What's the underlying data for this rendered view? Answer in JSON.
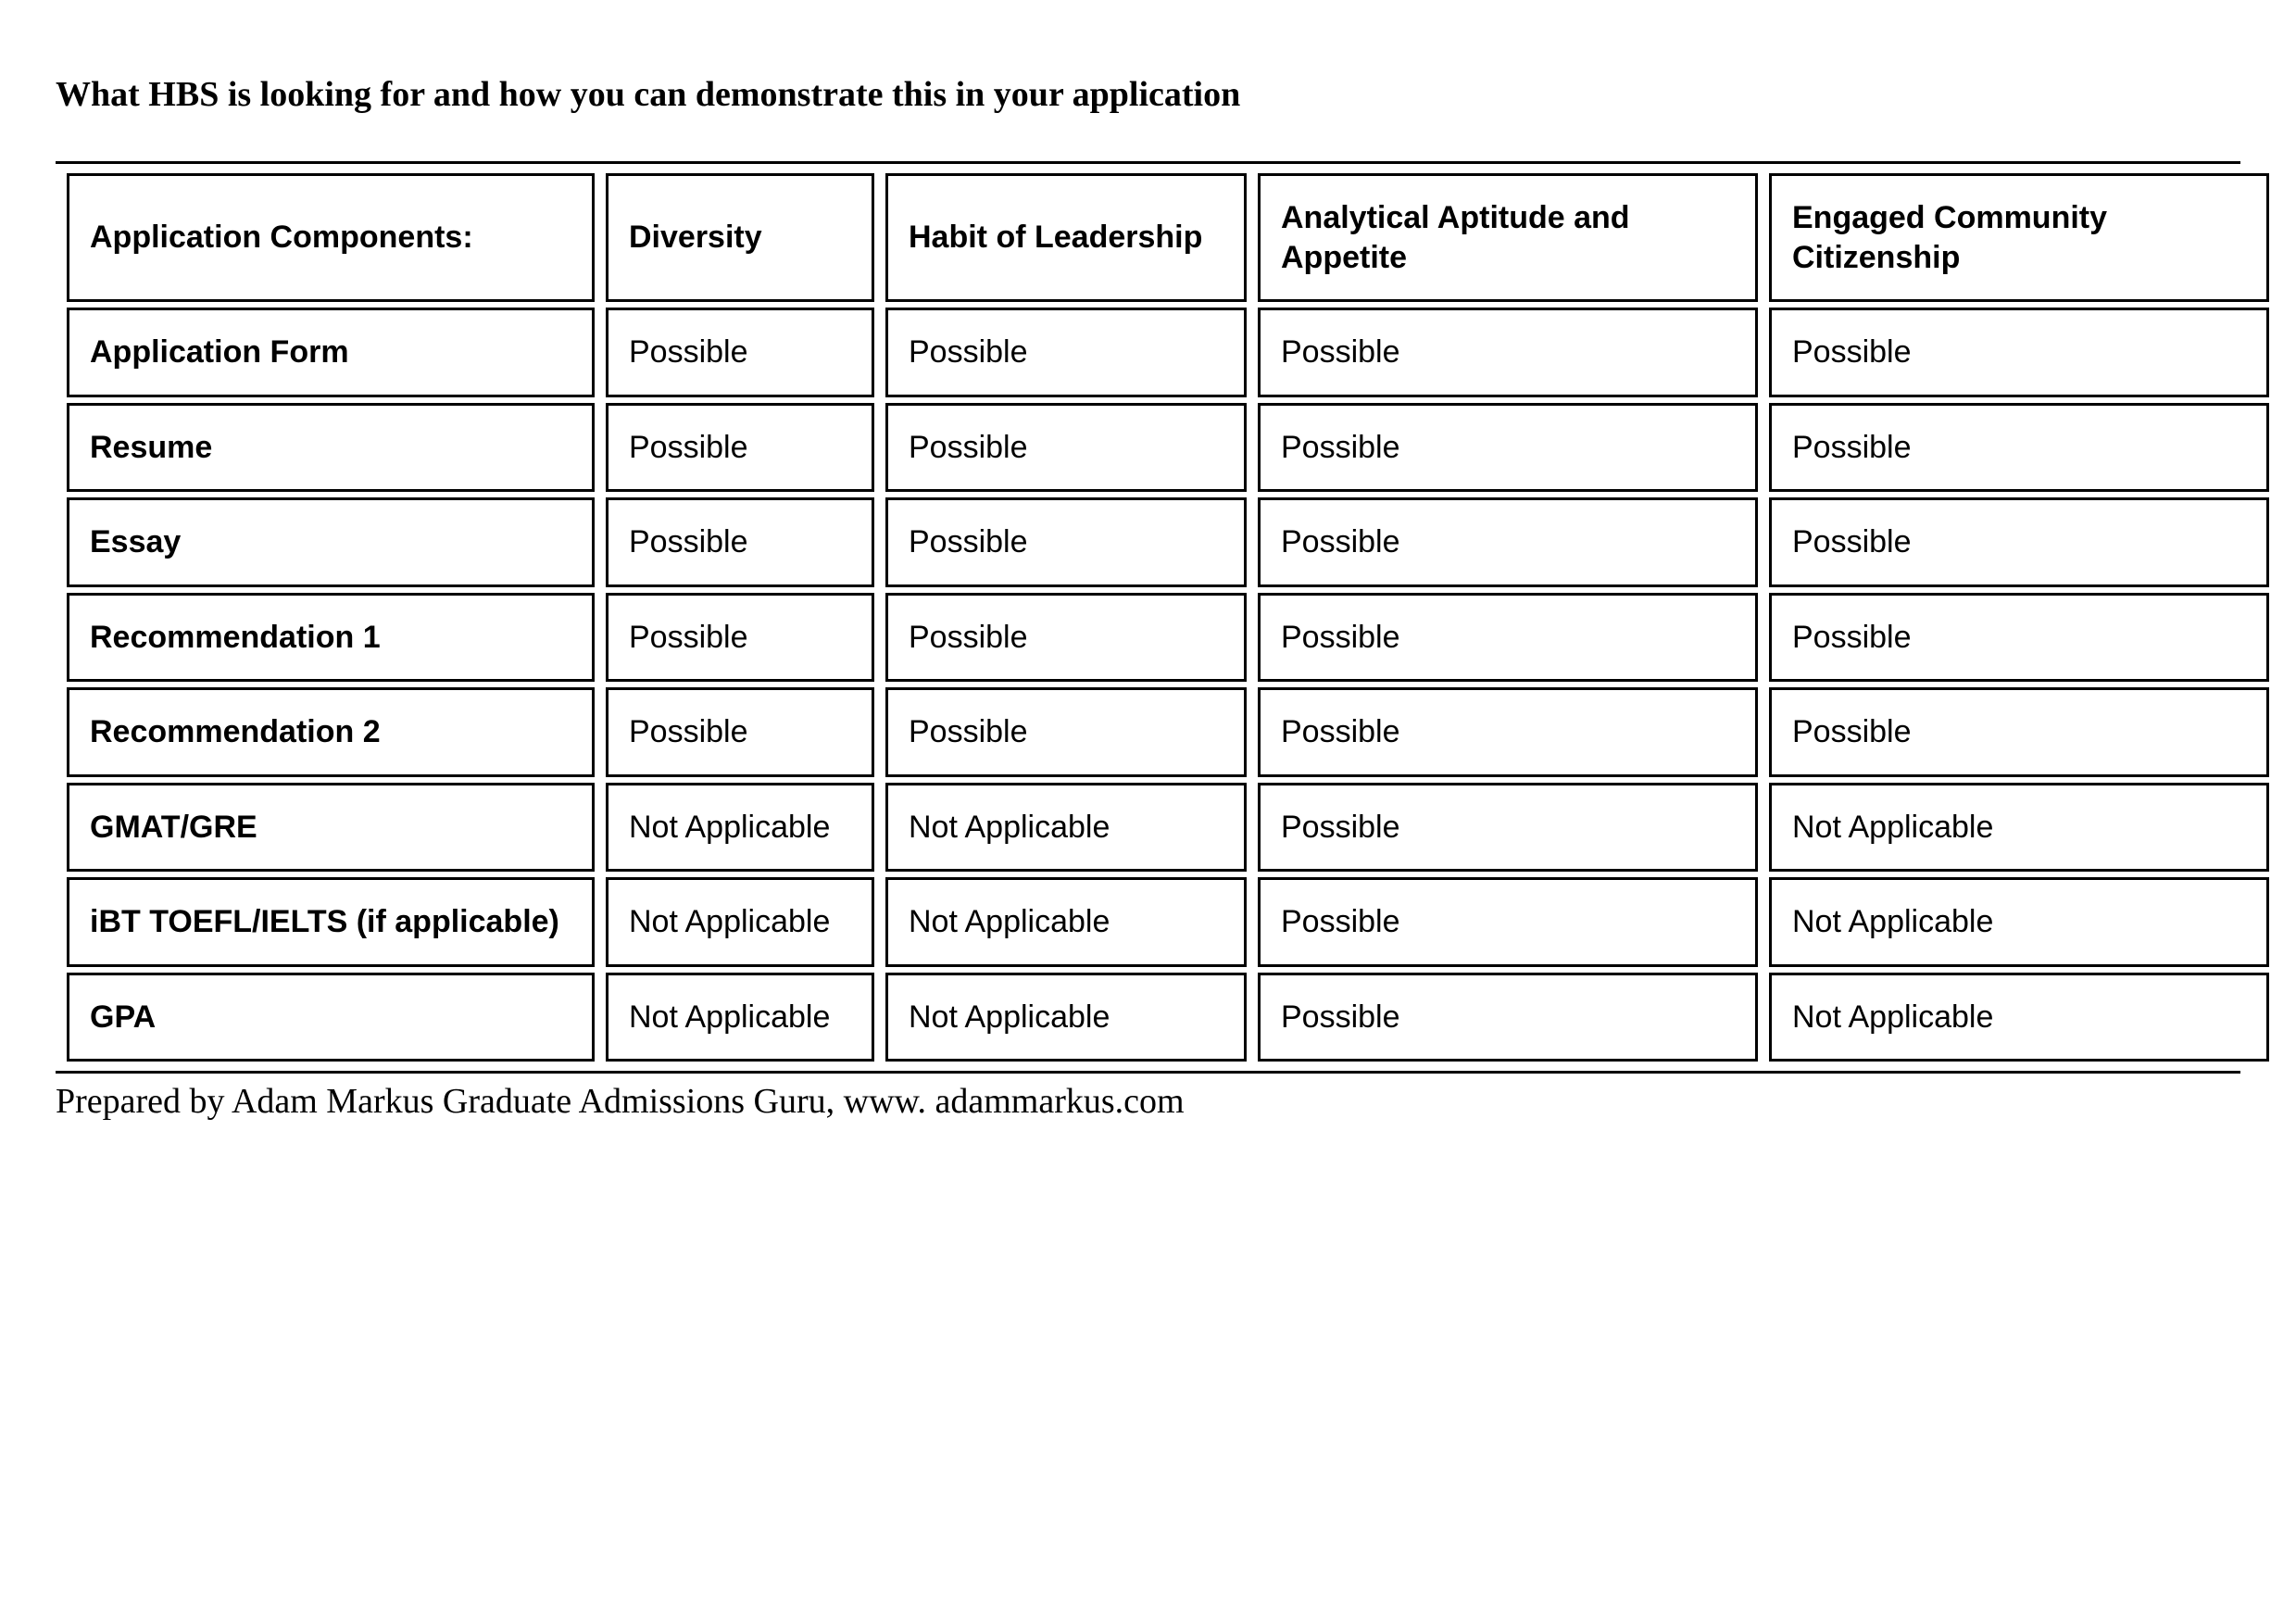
{
  "title": "What HBS is looking for and how you can demonstrate this in your application",
  "headers": {
    "c0": "Application Components:",
    "c1": "Diversity",
    "c2": "Habit of Leadership",
    "c3": "Analytical Aptitude and Appetite",
    "c4": "Engaged Community Citizenship"
  },
  "rows": [
    {
      "label": "Application Form",
      "c1": "Possible",
      "c2": "Possible",
      "c3": "Possible",
      "c4": "Possible"
    },
    {
      "label": "Resume",
      "c1": "Possible",
      "c2": "Possible",
      "c3": "Possible",
      "c4": "Possible"
    },
    {
      "label": "Essay",
      "c1": "Possible",
      "c2": "Possible",
      "c3": "Possible",
      "c4": "Possible"
    },
    {
      "label": "Recommendation 1",
      "c1": "Possible",
      "c2": "Possible",
      "c3": "Possible",
      "c4": "Possible"
    },
    {
      "label": "Recommendation 2",
      "c1": "Possible",
      "c2": "Possible",
      "c3": "Possible",
      "c4": "Possible"
    },
    {
      "label": "GMAT/GRE",
      "c1": "Not Applicable",
      "c2": "Not Applicable",
      "c3": "Possible",
      "c4": "Not Applicable"
    },
    {
      "label": "iBT TOEFL/IELTS (if applicable)",
      "c1": "Not Applicable",
      "c2": "Not Applicable",
      "c3": "Possible",
      "c4": "Not Applicable"
    },
    {
      "label": "GPA",
      "c1": "Not Applicable",
      "c2": "Not Applicable",
      "c3": "Possible",
      "c4": "Not Applicable"
    }
  ],
  "footer": "Prepared by Adam Markus Graduate Admissions Guru, www. adammarkus.com"
}
